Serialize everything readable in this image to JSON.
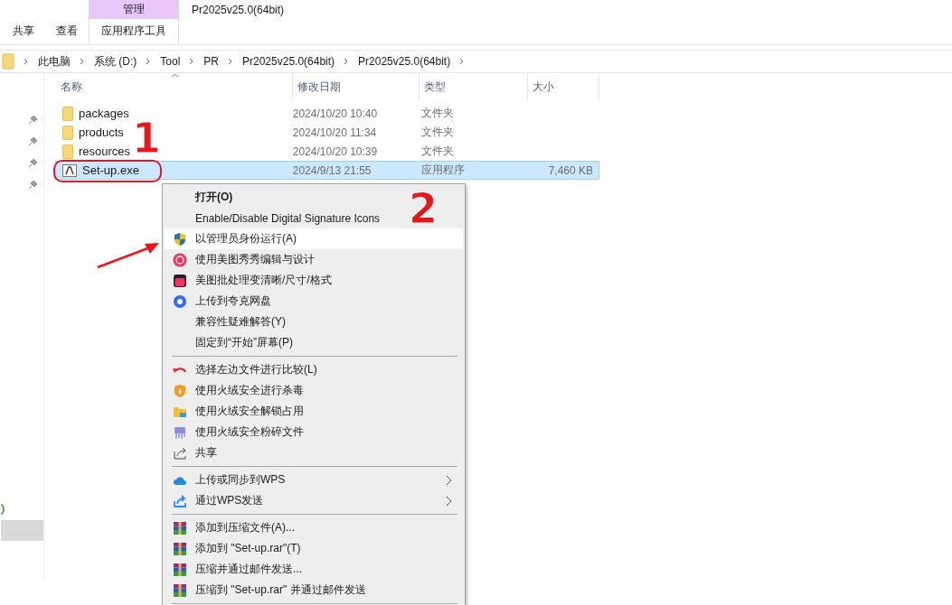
{
  "ribbon": {
    "context_tab_group": "管理",
    "window_title": "Pr2025v25.0(64bit)",
    "tabs": [
      {
        "label": "共享",
        "selected": false
      },
      {
        "label": "查看",
        "selected": false
      },
      {
        "label": "应用程序工具",
        "selected": true
      }
    ]
  },
  "breadcrumb": [
    "此电脑",
    "系统 (D:)",
    "Tool",
    "PR",
    "Pr2025v25.0(64bit)",
    "Pr2025v25.0(64bit)"
  ],
  "columns": [
    "名称",
    "修改日期",
    "类型",
    "大小"
  ],
  "files": [
    {
      "kind": "folder",
      "name": "packages",
      "date": "2024/10/20 10:40",
      "type": "文件夹",
      "selected": false
    },
    {
      "kind": "folder",
      "name": "products",
      "date": "2024/10/20 11:34",
      "type": "文件夹",
      "selected": false
    },
    {
      "kind": "folder",
      "name": "resources",
      "date": "2024/10/20 10:39",
      "type": "文件夹",
      "selected": false
    },
    {
      "kind": "exe",
      "name": "Set-up.exe",
      "date": "2024/9/13 21:55",
      "type": "应用程序",
      "size": "7,460 KB",
      "selected": true
    }
  ],
  "annotations": {
    "step_1": "1",
    "step_2": "2"
  },
  "context_menu": [
    {
      "kind": "plain",
      "label": "打开(O)",
      "bold": true,
      "selected": false
    },
    {
      "kind": "plain",
      "label": "Enable/Disable Digital Signature Icons",
      "bold": false,
      "selected": false
    },
    {
      "kind": "shield",
      "label": "以管理员身份运行(A)",
      "bold": false,
      "selected": true
    },
    {
      "kind": "meitu",
      "label": "使用美图秀秀编辑与设计",
      "bold": false,
      "selected": false
    },
    {
      "kind": "batch",
      "label": "美图批处理变清晰/尺寸/格式",
      "bold": false,
      "selected": false
    },
    {
      "kind": "quark",
      "label": "上传到夸克网盘",
      "bold": false,
      "selected": false
    },
    {
      "kind": "plain",
      "label": "兼容性疑难解答(Y)",
      "bold": false,
      "selected": false
    },
    {
      "kind": "plain",
      "label": "固定到“开始”屏幕(P)",
      "bold": false,
      "selected": false
    },
    {
      "kind": "separator"
    },
    {
      "kind": "undo",
      "label": "选择左边文件进行比较(L)",
      "bold": false,
      "selected": false
    },
    {
      "kind": "flame",
      "label": "使用火绒安全进行杀毒",
      "bold": false,
      "selected": false
    },
    {
      "kind": "unlock",
      "label": "使用火绒安全解锁占用",
      "bold": false,
      "selected": false
    },
    {
      "kind": "shredder",
      "label": "使用火绒安全粉碎文件",
      "bold": false,
      "selected": false
    },
    {
      "kind": "share",
      "label": "共享",
      "bold": false,
      "selected": false
    },
    {
      "kind": "separator"
    },
    {
      "kind": "cloud",
      "label": "上传或同步到WPS",
      "bold": false,
      "selected": false,
      "submenu": true
    },
    {
      "kind": "send",
      "label": "通过WPS发送",
      "bold": false,
      "selected": false,
      "submenu": true
    },
    {
      "kind": "separator"
    },
    {
      "kind": "archive",
      "label": "添加到压缩文件(A)...",
      "bold": false,
      "selected": false
    },
    {
      "kind": "archive",
      "label": "添加到 \"Set-up.rar\"(T)",
      "bold": false,
      "selected": false
    },
    {
      "kind": "archive",
      "label": "压缩并通过邮件发送...",
      "bold": false,
      "selected": false
    },
    {
      "kind": "archive",
      "label": "压缩到 \"Set-up.rar\" 并通过邮件发送",
      "bold": false,
      "selected": false
    },
    {
      "kind": "separator"
    }
  ]
}
